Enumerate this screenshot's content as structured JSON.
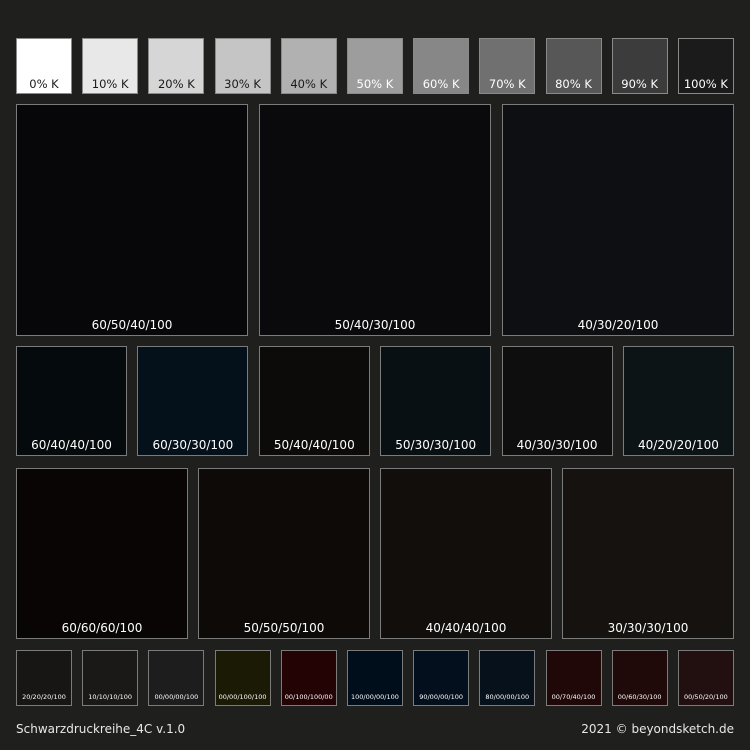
{
  "grey_row": [
    {
      "label": "0% K",
      "color": "#ffffff",
      "label_color": "#1a1a1a"
    },
    {
      "label": "10% K",
      "color": "#e8e8e8",
      "label_color": "#1a1a1a"
    },
    {
      "label": "20% K",
      "color": "#d6d6d6",
      "label_color": "#1a1a1a"
    },
    {
      "label": "30% K",
      "color": "#c5c5c5",
      "label_color": "#1a1a1a"
    },
    {
      "label": "40% K",
      "color": "#b1b1b1",
      "label_color": "#1a1a1a"
    },
    {
      "label": "50% K",
      "color": "#9d9d9d",
      "label_color": "#ffffff"
    },
    {
      "label": "60% K",
      "color": "#878787",
      "label_color": "#ffffff"
    },
    {
      "label": "70% K",
      "color": "#707070",
      "label_color": "#ffffff"
    },
    {
      "label": "80% K",
      "color": "#575757",
      "label_color": "#ffffff"
    },
    {
      "label": "90% K",
      "color": "#3c3c3c",
      "label_color": "#ffffff"
    },
    {
      "label": "100% K",
      "color": "#1b1b1b",
      "label_color": "#ffffff"
    }
  ],
  "big_row": [
    {
      "label": "60/50/40/100",
      "color": "#07070a"
    },
    {
      "label": "50/40/30/100",
      "color": "#0a0a0d"
    },
    {
      "label": "40/30/20/100",
      "color": "#0e0f12"
    }
  ],
  "mid_row": [
    {
      "label": "60/40/40/100",
      "color": "#050b0c"
    },
    {
      "label": "60/30/30/100",
      "color": "#04101a"
    },
    {
      "label": "50/40/40/100",
      "color": "#0c0b0a"
    },
    {
      "label": "50/30/30/100",
      "color": "#081013"
    },
    {
      "label": "40/30/30/100",
      "color": "#0f0e0e"
    },
    {
      "label": "40/20/20/100",
      "color": "#0c1416"
    }
  ],
  "large_row": [
    {
      "label": "60/60/60/100",
      "color": "#080504"
    },
    {
      "label": "50/50/50/100",
      "color": "#0d0a08"
    },
    {
      "label": "40/40/40/100",
      "color": "#110e0c"
    },
    {
      "label": "30/30/30/100",
      "color": "#15120f"
    }
  ],
  "small_row": [
    {
      "label": "20/20/20/100",
      "color": "#181614"
    },
    {
      "label": "10/10/10/100",
      "color": "#1a1918"
    },
    {
      "label": "00/00/00/100",
      "color": "#1d1d1d"
    },
    {
      "label": "00/00/100/100",
      "color": "#1b1a05"
    },
    {
      "label": "00/100/100/00",
      "color": "#230304"
    },
    {
      "label": "100/00/00/100",
      "color": "#000d1b"
    },
    {
      "label": "90/00/00/100",
      "color": "#030f1c"
    },
    {
      "label": "80/00/00/100",
      "color": "#07111c"
    },
    {
      "label": "00/70/40/100",
      "color": "#200809"
    },
    {
      "label": "00/60/30/100",
      "color": "#200909"
    },
    {
      "label": "00/50/20/100",
      "color": "#220f10"
    }
  ],
  "footer": {
    "left": "Schwarzdruckreihe_4C v.1.0",
    "right": "2021 © beyondsketch.de"
  }
}
